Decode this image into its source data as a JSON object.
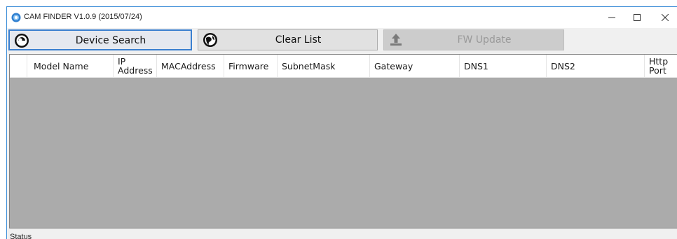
{
  "window": {
    "title": "CAM FINDER V1.0.9 (2015/07/24)",
    "accent_color": "#3c8dd8",
    "controls": {
      "minimize": "minimize-icon",
      "maximize": "maximize-icon",
      "close": "close-icon"
    }
  },
  "toolbar": {
    "device_search_label": "Device Search",
    "device_search_icon": "search-globe-icon",
    "clear_list_label": "Clear List",
    "clear_list_icon": "globe-icon",
    "fw_update_label": "FW Update",
    "fw_update_icon": "upload-icon",
    "fw_update_enabled": false
  },
  "table": {
    "columns": [
      "",
      "Model Name",
      "IP Address",
      "MACAddress",
      "Firmware",
      "SubnetMask",
      "Gateway",
      "DNS1",
      "DNS2",
      "Http Port"
    ],
    "rows": []
  },
  "status": {
    "label": "Status"
  }
}
